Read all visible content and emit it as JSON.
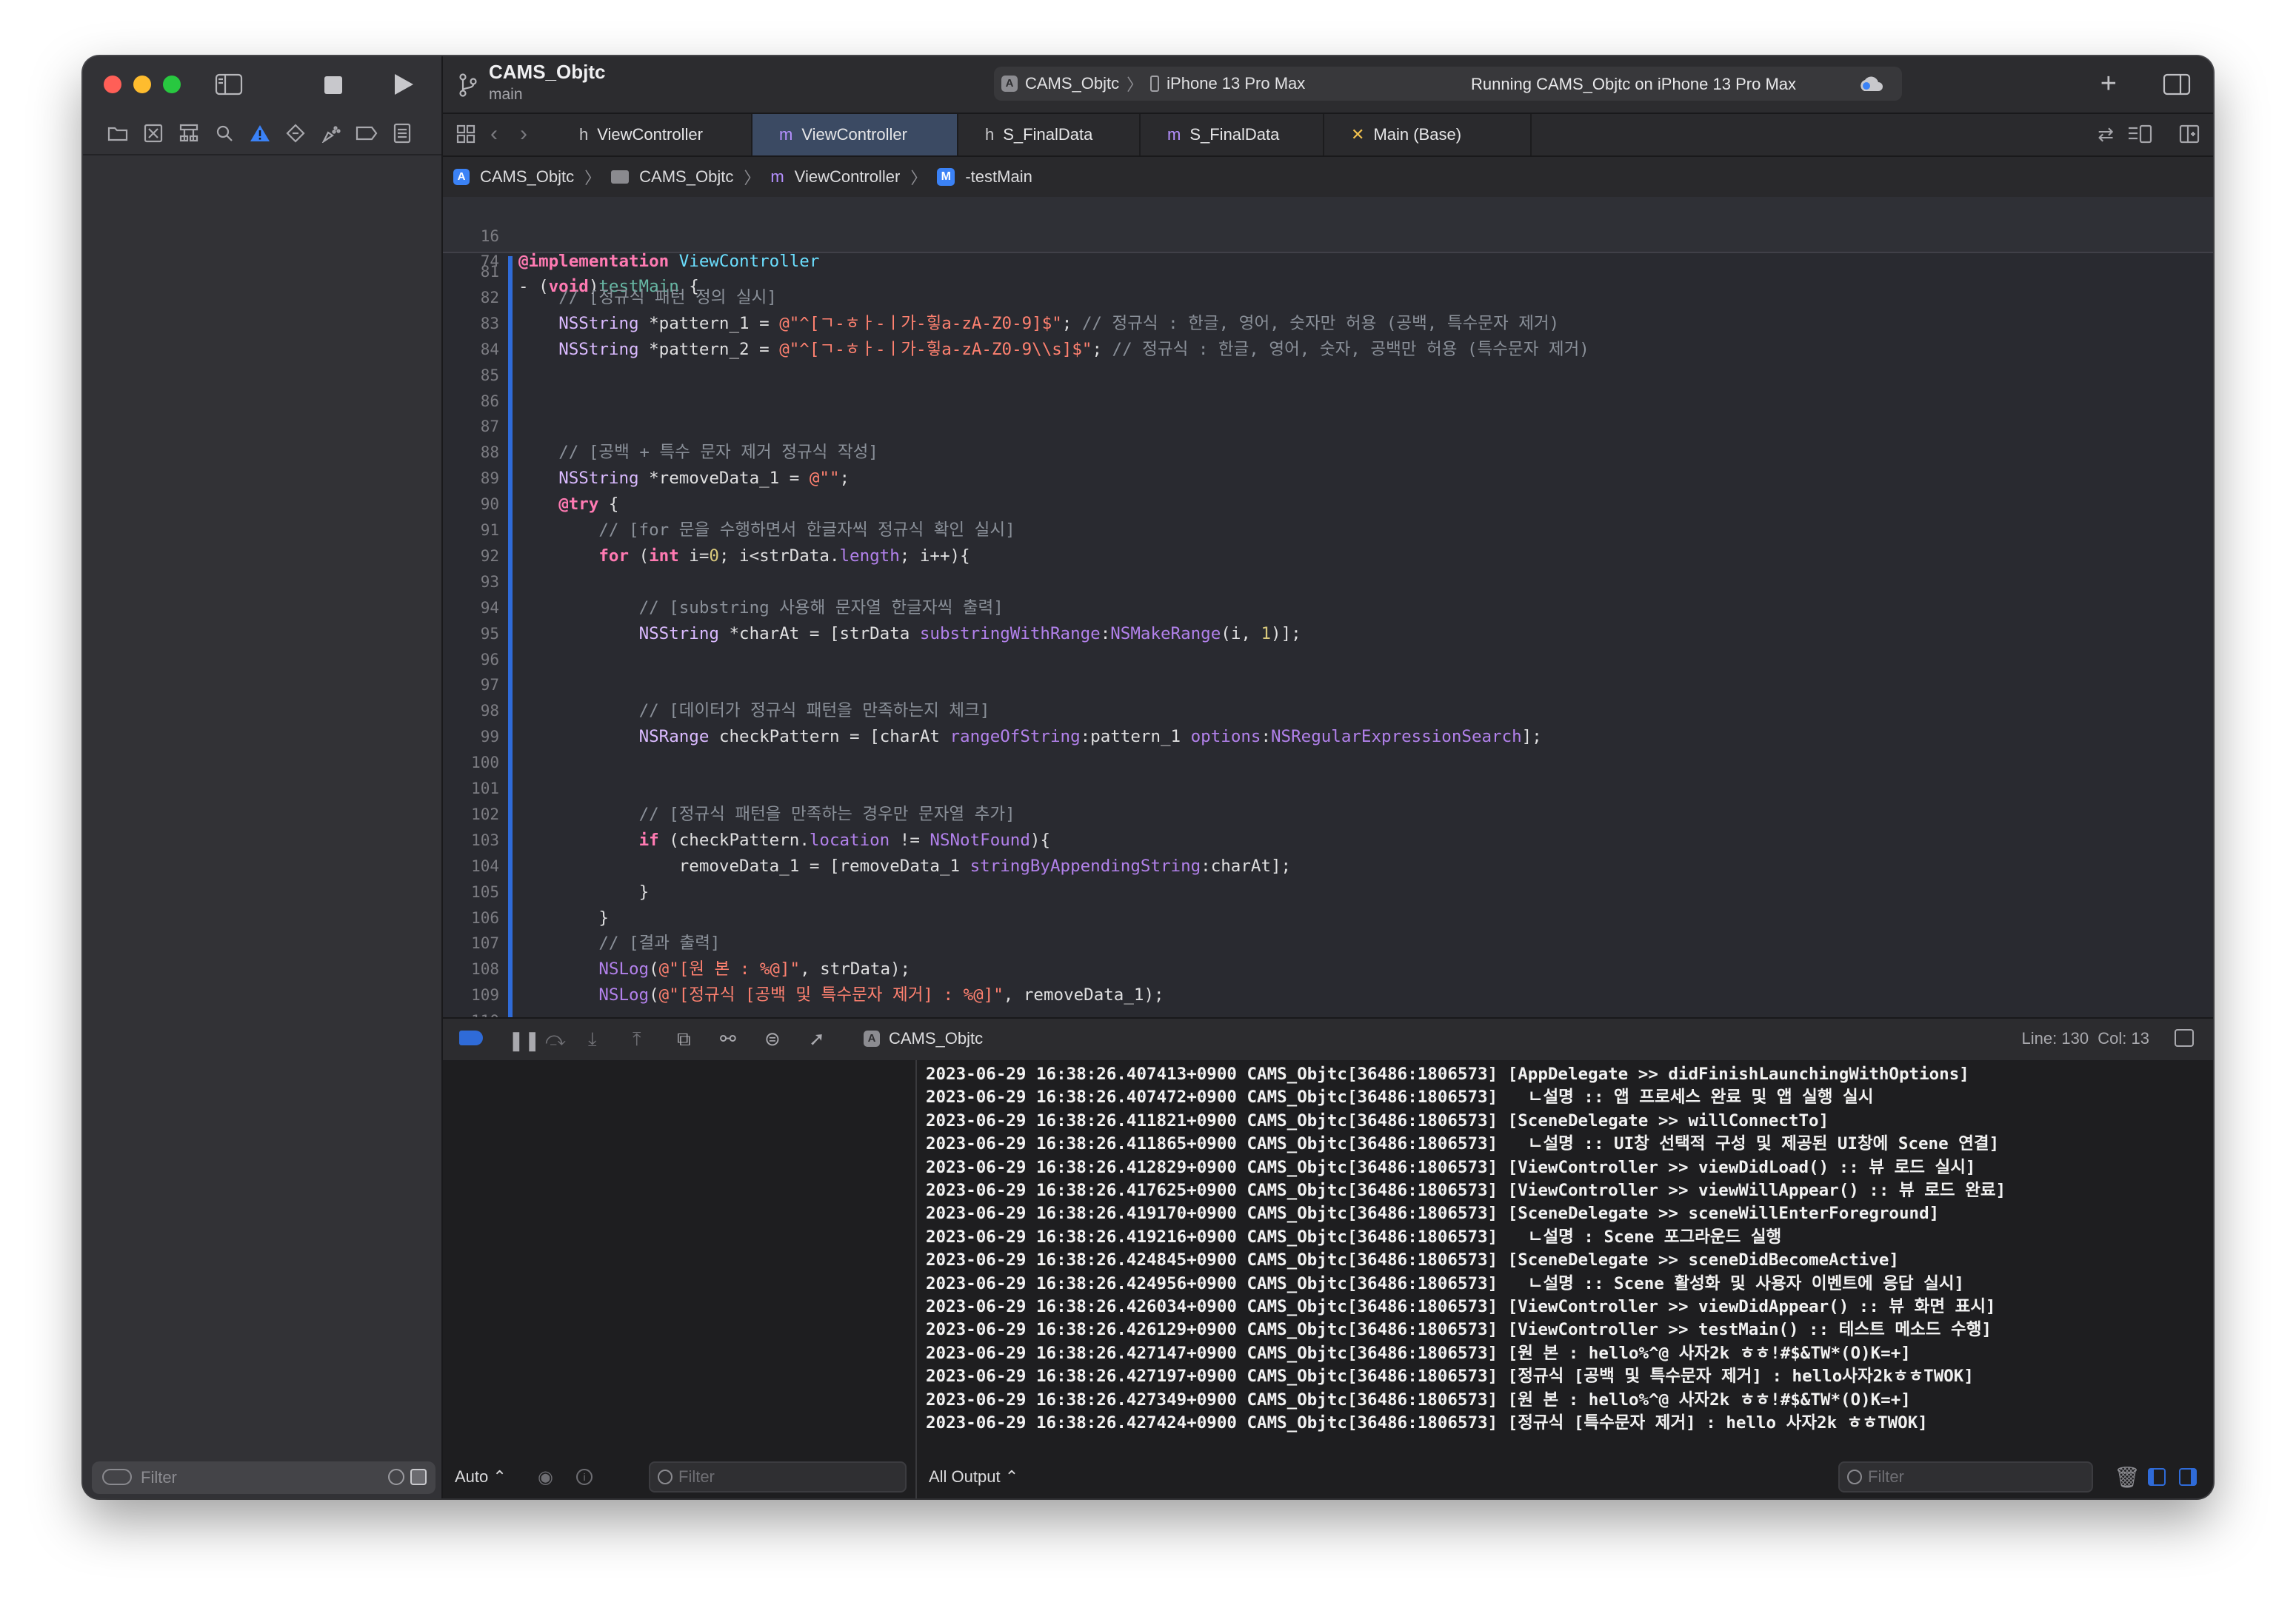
{
  "window": {
    "project_name": "CAMS_Objtc",
    "branch": "main",
    "scheme": "CAMS_Objtc",
    "device": "iPhone 13 Pro Max",
    "status": "Running CAMS_Objtc on iPhone 13 Pro Max"
  },
  "tabs": [
    {
      "label": "ViewController",
      "icon": "h-file-icon",
      "glyph": "h"
    },
    {
      "label": "ViewController",
      "icon": "m-file-icon",
      "glyph": "m",
      "active": true
    },
    {
      "label": "S_FinalData",
      "icon": "h-file-icon",
      "glyph": "h"
    },
    {
      "label": "S_FinalData",
      "icon": "m-file-icon",
      "glyph": "m"
    },
    {
      "label": "Main (Base)",
      "icon": "storyboard-icon",
      "glyph": "✕"
    }
  ],
  "breadcrumb": [
    "CAMS_Objtc",
    "CAMS_Objtc",
    "ViewController",
    "-testMain"
  ],
  "code": {
    "sticky": [
      {
        "n": "16",
        "text": "@implementation ViewController"
      },
      {
        "n": "74",
        "text": "- (void)testMain {"
      }
    ],
    "lines": [
      {
        "n": "81",
        "text": ""
      },
      {
        "n": "82",
        "text": "    // [정규식 패턴 정의 실시]"
      },
      {
        "n": "83",
        "text": "    NSString *pattern_1 = @\"^[ㄱ-ㅎㅏ-ㅣ가-힣a-zA-Z0-9]$\"; // 정규식 : 한글, 영어, 숫자만 허용 (공백, 특수문자 제거)"
      },
      {
        "n": "84",
        "text": "    NSString *pattern_2 = @\"^[ㄱ-ㅎㅏ-ㅣ가-힣a-zA-Z0-9\\\\s]$\"; // 정규식 : 한글, 영어, 숫자, 공백만 허용 (특수문자 제거)"
      },
      {
        "n": "85",
        "text": ""
      },
      {
        "n": "86",
        "text": ""
      },
      {
        "n": "87",
        "text": ""
      },
      {
        "n": "88",
        "text": "    // [공백 + 특수 문자 제거 정규식 작성]"
      },
      {
        "n": "89",
        "text": "    NSString *removeData_1 = @\"\";"
      },
      {
        "n": "90",
        "text": "    @try {"
      },
      {
        "n": "91",
        "text": "        // [for 문을 수행하면서 한글자씩 정규식 확인 실시]"
      },
      {
        "n": "92",
        "text": "        for (int i=0; i<strData.length; i++){"
      },
      {
        "n": "93",
        "text": ""
      },
      {
        "n": "94",
        "text": "            // [substring 사용해 문자열 한글자씩 출력]"
      },
      {
        "n": "95",
        "text": "            NSString *charAt = [strData substringWithRange:NSMakeRange(i, 1)];"
      },
      {
        "n": "96",
        "text": ""
      },
      {
        "n": "97",
        "text": ""
      },
      {
        "n": "98",
        "text": "            // [데이터가 정규식 패턴을 만족하는지 체크]"
      },
      {
        "n": "99",
        "text": "            NSRange checkPattern = [charAt rangeOfString:pattern_1 options:NSRegularExpressionSearch];"
      },
      {
        "n": "100",
        "text": ""
      },
      {
        "n": "101",
        "text": ""
      },
      {
        "n": "102",
        "text": "            // [정규식 패턴을 만족하는 경우만 문자열 추가]"
      },
      {
        "n": "103",
        "text": "            if (checkPattern.location != NSNotFound){"
      },
      {
        "n": "104",
        "text": "                removeData_1 = [removeData_1 stringByAppendingString:charAt];"
      },
      {
        "n": "105",
        "text": "            }"
      },
      {
        "n": "106",
        "text": "        }"
      },
      {
        "n": "107",
        "text": "        // [결과 출력]"
      },
      {
        "n": "108",
        "text": "        NSLog(@\"[원 본 : %@]\", strData);"
      },
      {
        "n": "109",
        "text": "        NSLog(@\"[정규식 [공백 및 특수문자 제거] : %@]\", removeData_1);"
      },
      {
        "n": "110",
        "text": ""
      }
    ]
  },
  "debug_bar": {
    "target": "CAMS_Objtc",
    "position": "Line: 130  Col: 13"
  },
  "console": {
    "lines": [
      "2023-06-29 16:38:26.407413+0900 CAMS_Objtc[36486:1806573] [AppDelegate >> didFinishLaunchingWithOptions]",
      "2023-06-29 16:38:26.407472+0900 CAMS_Objtc[36486:1806573]   ㄴ설명 :: 앱 프로세스 완료 및 앱 실행 실시",
      "2023-06-29 16:38:26.411821+0900 CAMS_Objtc[36486:1806573] [SceneDelegate >> willConnectTo]",
      "2023-06-29 16:38:26.411865+0900 CAMS_Objtc[36486:1806573]   ㄴ설명 :: UI창 선택적 구성 및 제공된 UI창에 Scene 연결]",
      "2023-06-29 16:38:26.412829+0900 CAMS_Objtc[36486:1806573] [ViewController >> viewDidLoad() :: 뷰 로드 실시]",
      "2023-06-29 16:38:26.417625+0900 CAMS_Objtc[36486:1806573] [ViewController >> viewWillAppear() :: 뷰 로드 완료]",
      "2023-06-29 16:38:26.419170+0900 CAMS_Objtc[36486:1806573] [SceneDelegate >> sceneWillEnterForeground]",
      "2023-06-29 16:38:26.419216+0900 CAMS_Objtc[36486:1806573]   ㄴ설명 : Scene 포그라운드 실행",
      "2023-06-29 16:38:26.424845+0900 CAMS_Objtc[36486:1806573] [SceneDelegate >> sceneDidBecomeActive]",
      "2023-06-29 16:38:26.424956+0900 CAMS_Objtc[36486:1806573]   ㄴ설명 :: Scene 활성화 및 사용자 이벤트에 응답 실시]",
      "2023-06-29 16:38:26.426034+0900 CAMS_Objtc[36486:1806573] [ViewController >> viewDidAppear() :: 뷰 화면 표시]",
      "2023-06-29 16:38:26.426129+0900 CAMS_Objtc[36486:1806573] [ViewController >> testMain() :: 테스트 메소드 수행]",
      "2023-06-29 16:38:26.427147+0900 CAMS_Objtc[36486:1806573] [원 본 : hello%^@ 사자2k ㅎㅎ!#$&TW*(O)K=+]",
      "2023-06-29 16:38:26.427197+0900 CAMS_Objtc[36486:1806573] [정규식 [공백 및 특수문자 제거] : hello사자2kㅎㅎTWOK]",
      "2023-06-29 16:38:26.427349+0900 CAMS_Objtc[36486:1806573] [원 본 : hello%^@ 사자2k ㅎㅎ!#$&TW*(O)K=+]",
      "2023-06-29 16:38:26.427424+0900 CAMS_Objtc[36486:1806573] [정규식 [특수문자 제거] : hello 사자2k ㅎㅎTWOK]"
    ]
  },
  "footer": {
    "sidebar_filter_placeholder": "Filter",
    "variables_mode": "Auto ⌃",
    "variables_filter_placeholder": "Filter",
    "output_mode": "All Output ⌃",
    "console_filter_placeholder": "Filter"
  },
  "colors": {
    "accent": "#2f6bd8",
    "keyword": "#ff7ab2",
    "string": "#ff8170",
    "comment": "#8a9099",
    "warning": "#3b82f6"
  }
}
